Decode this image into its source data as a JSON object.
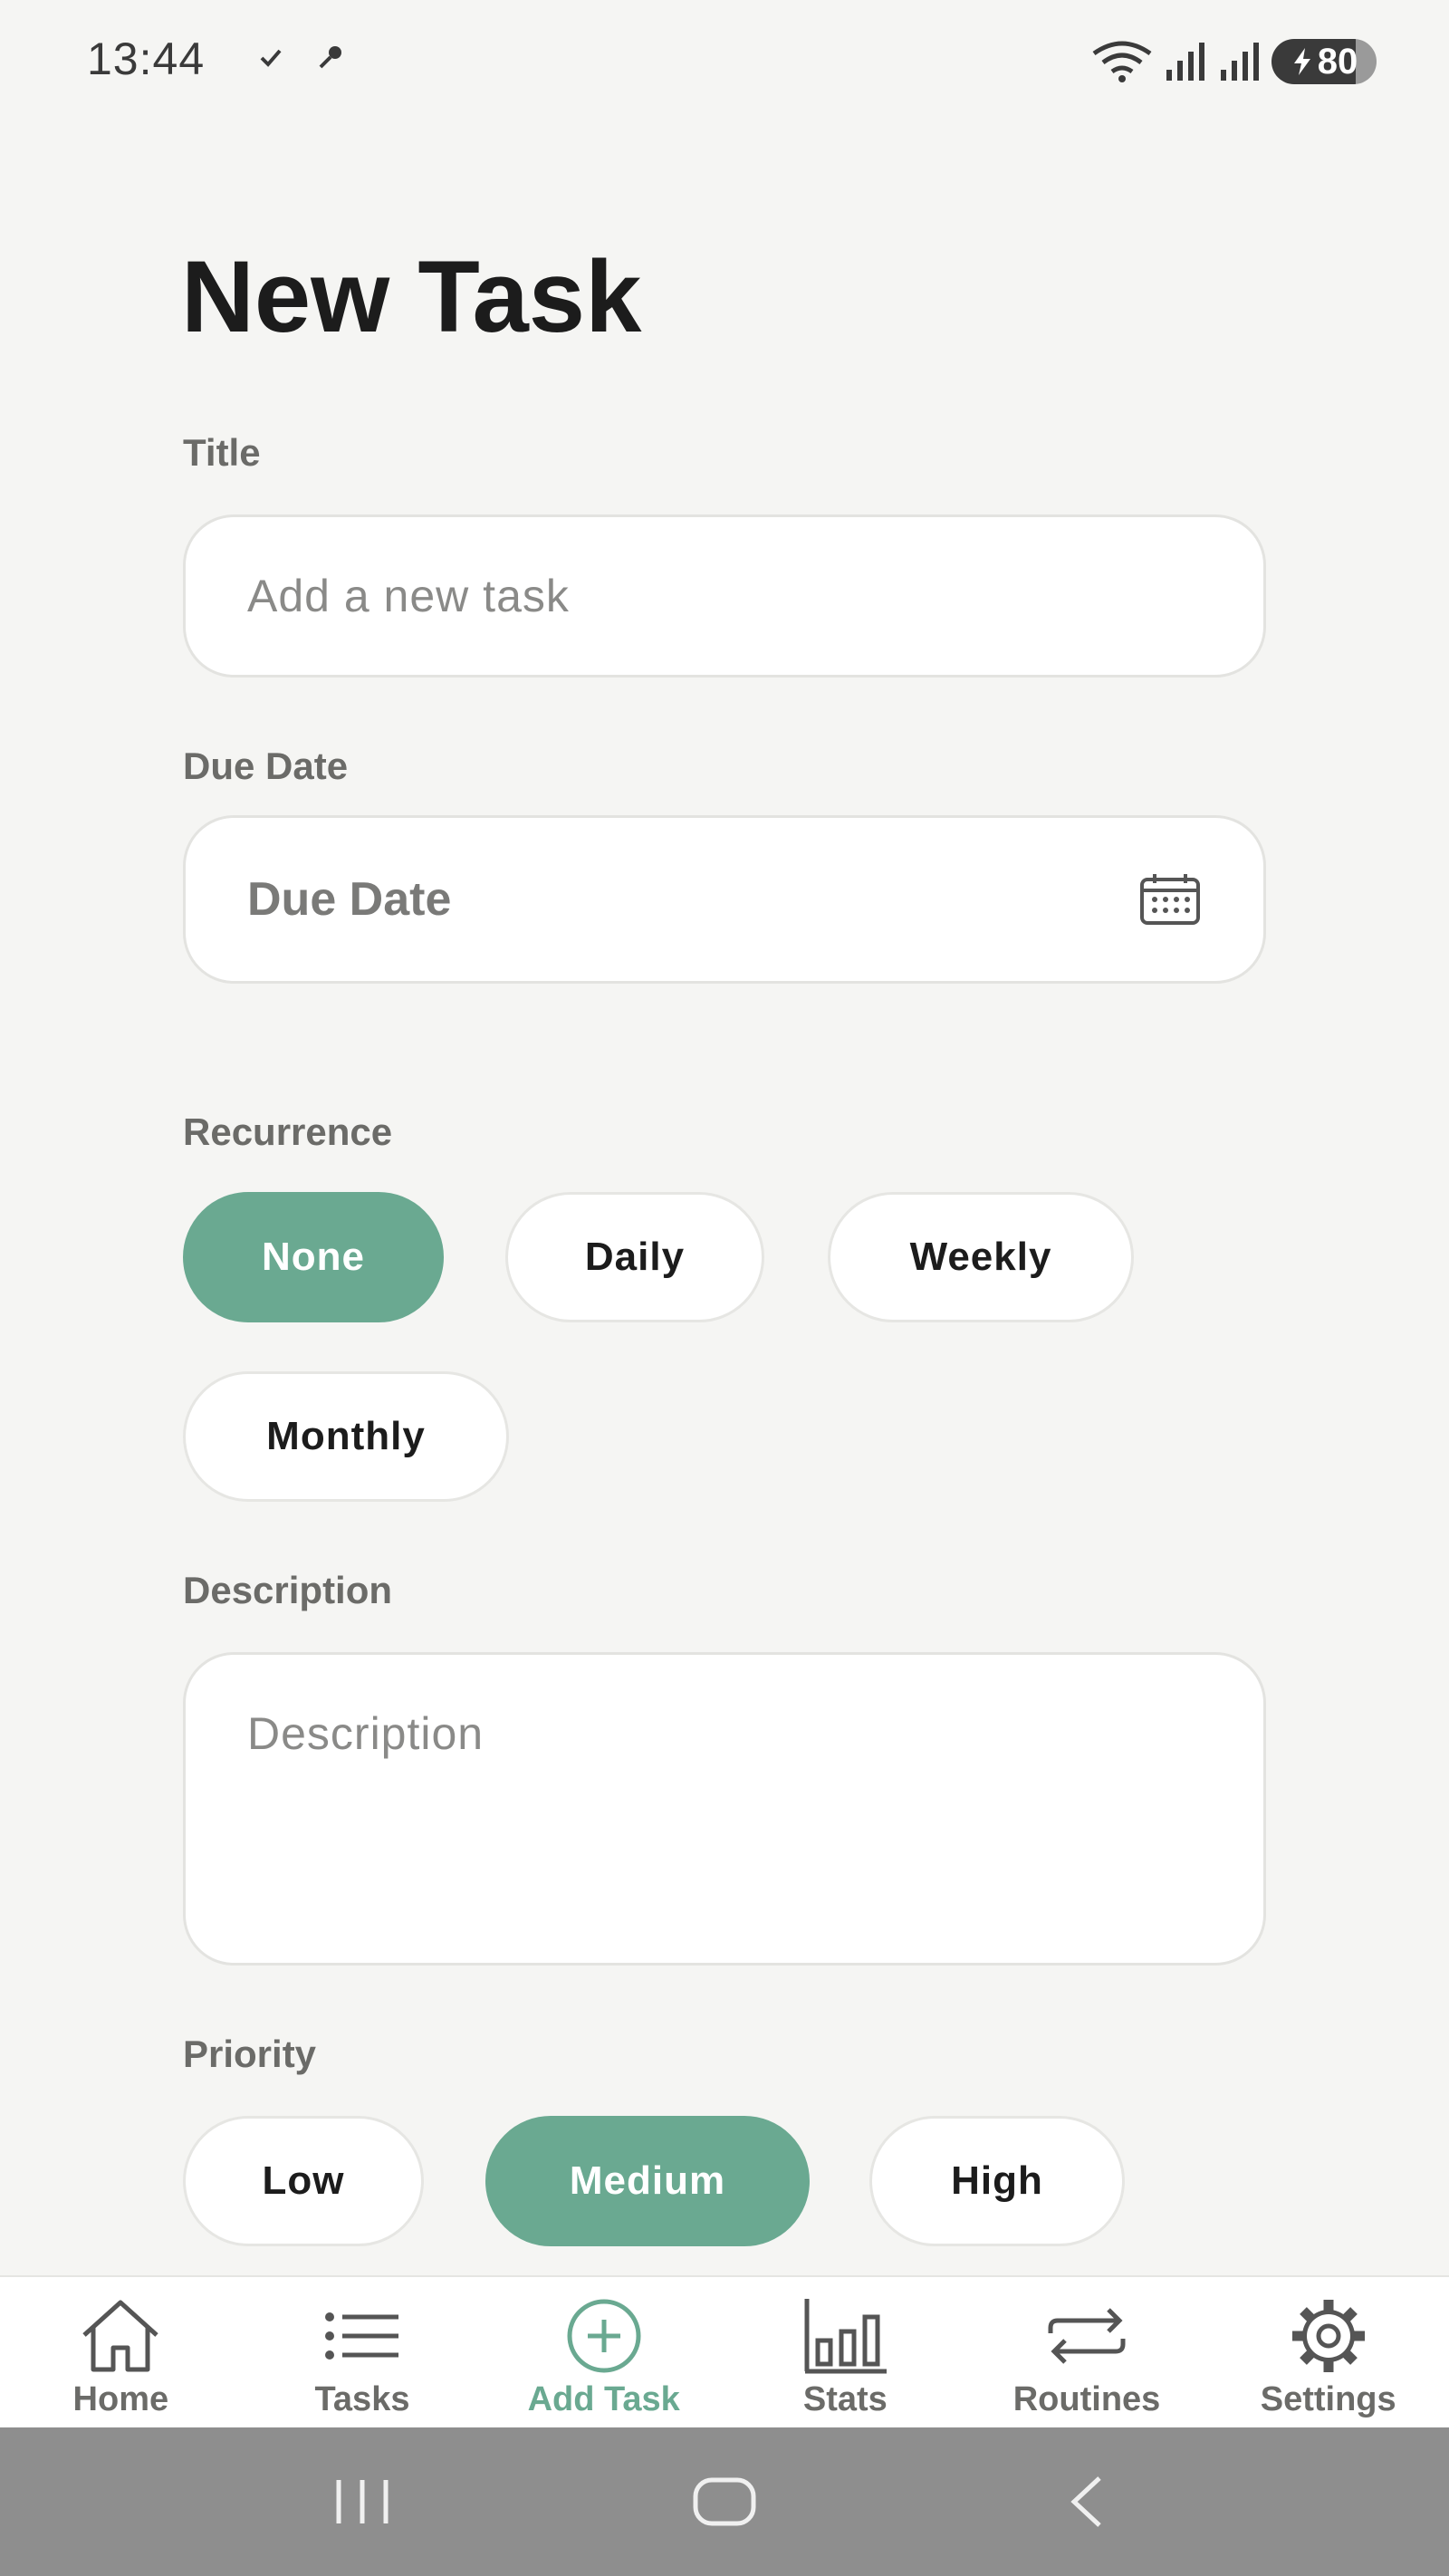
{
  "status_bar": {
    "time": "13:44",
    "battery_level": "80",
    "icons": [
      "check-icon",
      "key-icon",
      "wifi-icon",
      "signal-icon",
      "signal-icon",
      "charging-icon"
    ]
  },
  "page": {
    "title": "New Task"
  },
  "form": {
    "title_label": "Title",
    "title_placeholder": "Add a new task",
    "title_value": "",
    "due_date_label": "Due Date",
    "due_date_text": "Due Date",
    "recurrence_label": "Recurrence",
    "recurrence_options": [
      "None",
      "Daily",
      "Weekly",
      "Monthly"
    ],
    "recurrence_selected": "None",
    "description_label": "Description",
    "description_placeholder": "Description",
    "description_value": "",
    "priority_label": "Priority",
    "priority_options": [
      "Low",
      "Medium",
      "High"
    ],
    "priority_selected": "Medium"
  },
  "bottom_nav": {
    "items": [
      {
        "label": "Home",
        "icon": "home-icon"
      },
      {
        "label": "Tasks",
        "icon": "list-icon"
      },
      {
        "label": "Add Task",
        "icon": "add-circle-icon"
      },
      {
        "label": "Stats",
        "icon": "bar-chart-icon"
      },
      {
        "label": "Routines",
        "icon": "repeat-icon"
      },
      {
        "label": "Settings",
        "icon": "gear-icon"
      }
    ],
    "active": "Add Task"
  },
  "system_nav": {
    "buttons": [
      "recents-icon",
      "home-button-icon",
      "back-icon"
    ]
  },
  "colors": {
    "accent": "#6aa991",
    "background": "#f5f5f3",
    "text_primary": "#1c1c1c",
    "text_secondary": "#6b6b68",
    "system_bar": "#8e8e8e"
  }
}
